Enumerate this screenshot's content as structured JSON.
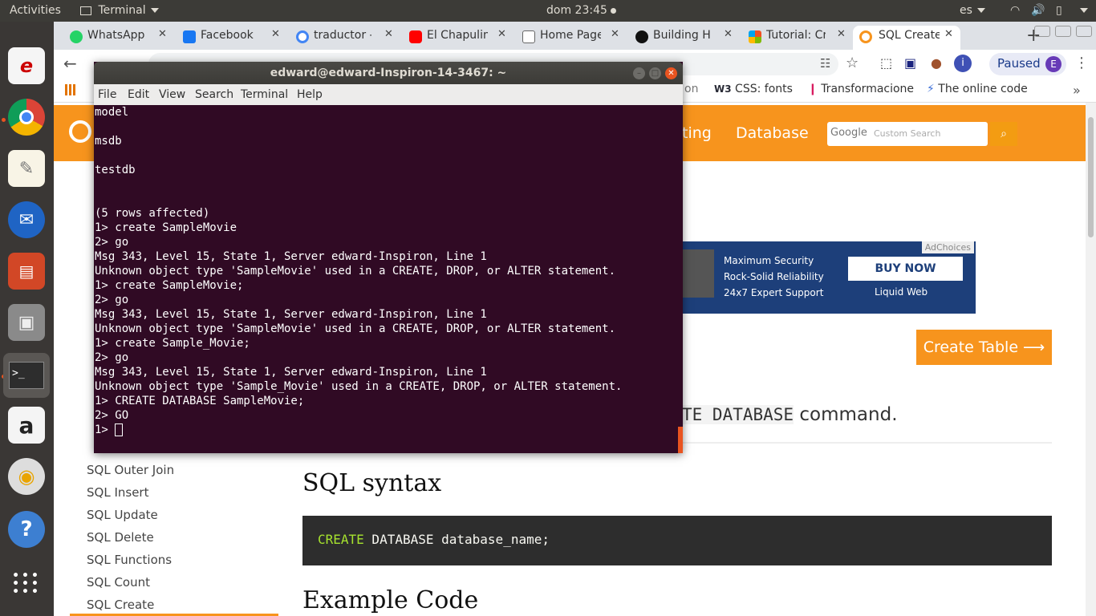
{
  "topbar": {
    "activities": "Activities",
    "app_name": "Terminal",
    "clock": "dom 23:45",
    "lang": "es"
  },
  "dock": {
    "items": [
      "lenovo-app",
      "chrome",
      "text-editor",
      "thunderbird",
      "impress",
      "files",
      "terminal",
      "amazon",
      "rhythmbox",
      "help",
      "show-applications"
    ]
  },
  "browser": {
    "tabs": [
      {
        "title": "WhatsApp",
        "icon": "whatsapp-icon"
      },
      {
        "title": "Facebook",
        "icon": "facebook-icon"
      },
      {
        "title": "traductor -",
        "icon": "google-icon"
      },
      {
        "title": "El Chapulin",
        "icon": "youtube-icon"
      },
      {
        "title": "Home Page",
        "icon": "page-icon"
      },
      {
        "title": "Building H",
        "icon": "github-icon"
      },
      {
        "title": "Tutorial: Cr",
        "icon": "microsoft-icon"
      },
      {
        "title": "SQL Create",
        "icon": "search-icon"
      }
    ],
    "paused_label": "Paused",
    "avatar_letter": "E",
    "bookmarks": [
      {
        "label": "on"
      },
      {
        "label": "CSS: fonts",
        "prefix": "W3"
      },
      {
        "label": "Transformacione"
      },
      {
        "label": "The online code"
      }
    ]
  },
  "page": {
    "nav_items": [
      "ting",
      "Database"
    ],
    "search_placeholder": "Custom Search",
    "search_brand": "Google",
    "ad": {
      "adchoices": "AdChoices",
      "features": [
        "Maximum Security",
        "Rock-Solid Reliability",
        "24x7 Expert Support"
      ],
      "cta": "BUY NOW",
      "brand": "Liquid Web"
    },
    "create_table_button": "Create Table ⟶",
    "command_tail": "TE DATABASE",
    "command_suffix": "command.",
    "sidebar_links": [
      "SQL Outer Join",
      "SQL Insert",
      "SQL Update",
      "SQL Delete",
      "SQL Functions",
      "SQL Count",
      "SQL Create"
    ],
    "heading_syntax": "SQL syntax",
    "code_keyword": "CREATE",
    "code_rest": " DATABASE database_name;",
    "heading_example": "Example Code"
  },
  "terminal": {
    "title": "edward@edward-Inspiron-14-3467: ~",
    "menu": [
      "File",
      "Edit",
      "View",
      "Search",
      "Terminal",
      "Help"
    ],
    "lines": [
      "model",
      "",
      "msdb",
      "",
      "testdb",
      "",
      "",
      "(5 rows affected)",
      "1> create SampleMovie",
      "2> go",
      "Msg 343, Level 15, State 1, Server edward-Inspiron, Line 1",
      "Unknown object type 'SampleMovie' used in a CREATE, DROP, or ALTER statement.",
      "1> create SampleMovie;",
      "2> go",
      "Msg 343, Level 15, State 1, Server edward-Inspiron, Line 1",
      "Unknown object type 'SampleMovie' used in a CREATE, DROP, or ALTER statement.",
      "1> create Sample_Movie;",
      "2> go",
      "Msg 343, Level 15, State 1, Server edward-Inspiron, Line 1",
      "Unknown object type 'Sample_Movie' used in a CREATE, DROP, or ALTER statement.",
      "1> CREATE DATABASE SampleMovie;",
      "2> GO"
    ],
    "prompt": "1> "
  }
}
